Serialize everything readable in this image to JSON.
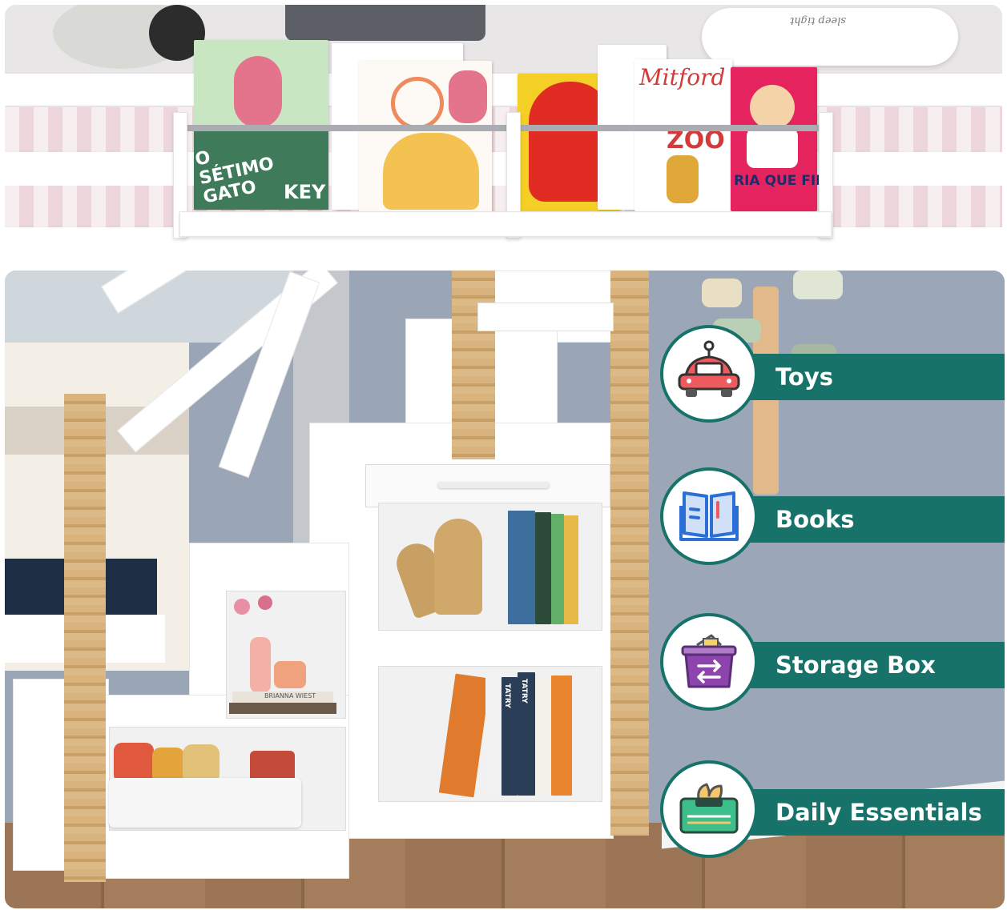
{
  "features": [
    {
      "label": "Toys",
      "icon": "toy-car-icon"
    },
    {
      "label": "Books",
      "icon": "book-icon"
    },
    {
      "label": "Storage Box",
      "icon": "storage-box-icon"
    },
    {
      "label": "Daily Essentials",
      "icon": "tissue-box-icon"
    }
  ],
  "top_scene": {
    "pillow_text": "sleep tight",
    "book_covers": [
      "O SÉTIMO GATO",
      "KEY",
      "Mitford",
      "ZOO",
      "RIA QUE FIM."
    ]
  },
  "bottom_scene": {
    "book_spines": [
      "TATRY",
      "TATRY"
    ],
    "shelf_book": "BRIANNA WIEST"
  },
  "colors": {
    "teal": "#17736a",
    "wood": "#d2aa72",
    "wall": "#9aa6b6",
    "icon_red": "#ef5a5f",
    "icon_blue": "#2b6fd6",
    "icon_purple": "#8e44ad",
    "icon_green": "#3cbf8a"
  }
}
